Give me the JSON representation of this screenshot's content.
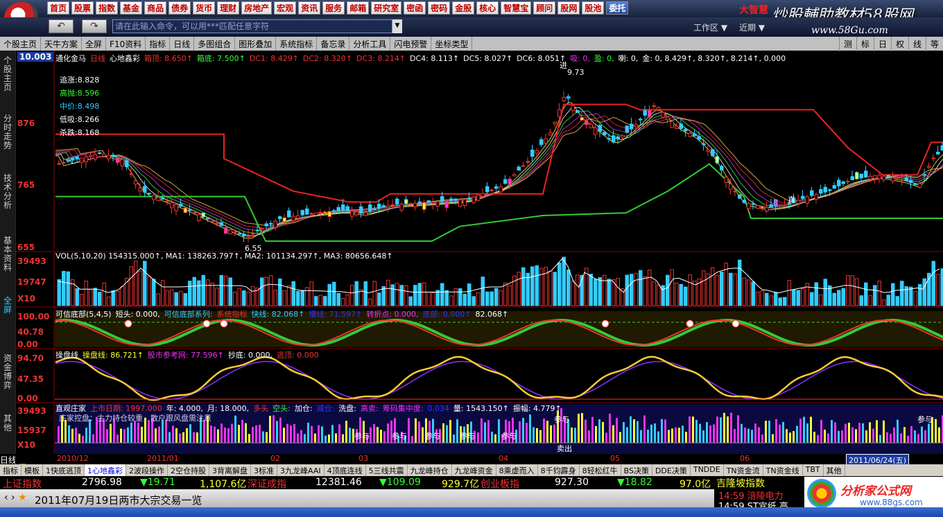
{
  "menu": [
    "首页",
    "股票",
    "指数",
    "基金",
    "商品",
    "债券",
    "货币",
    "理财",
    "房地产",
    "宏观",
    "资讯",
    "服务",
    "邮箱",
    "研究室",
    "密函",
    "密码",
    "金股",
    "核心",
    "智慧宝",
    "顾问",
    "股网",
    "股池",
    "委托"
  ],
  "brand": "大智慧",
  "watermark": "炒股輔助教材58股网",
  "watermark_url": "www.58Gu.com",
  "cmd": {
    "placeholder": "请在此输入命令，可以用***匹配任意字符"
  },
  "workarea": "工作区 ▼",
  "recent": "近期 ▼",
  "toolbar": [
    "个股主页",
    "天牛方案",
    "全屏",
    "F10资料",
    "指标",
    "日线",
    "多图组合",
    "图形叠加",
    "系统指标",
    "备忘录",
    "分析工具",
    "闪电预警",
    "坐标类型"
  ],
  "toolbar_right": [
    "测",
    "标",
    "日",
    "权",
    "线",
    "等"
  ],
  "sidetabs": [
    "个股主页",
    "分时走势",
    "技术分析",
    "基本资料",
    "全屏",
    "资金博弈",
    "其他"
  ],
  "main": {
    "header": [
      [
        "通化金马",
        "#fff"
      ],
      [
        "日线",
        "#e33"
      ],
      [
        "心地鑫彩",
        "#fff"
      ],
      [
        "箱顶: 8.650↑",
        "#e33"
      ],
      [
        "箱底: 7.500↑",
        "#3f3"
      ],
      [
        "DC1: 8.429↑",
        "#e33"
      ],
      [
        "DC2: 8.320↑",
        "#e33"
      ],
      [
        "DC3: 8.214↑",
        "#e33"
      ],
      [
        "DC4: 8.113↑",
        "#fff"
      ],
      [
        "DC5: 8.027↑",
        "#fff"
      ],
      [
        "DC6: 8.051↑",
        "#fff"
      ],
      [
        "吸: 0,",
        "#e3e"
      ],
      [
        "盈: 0,",
        "#3f3"
      ],
      [
        "喇: 0,",
        "#fff"
      ],
      [
        "金: 0, 8.429↑, 8.320↑, 8.214↑, 0.000",
        "#fff"
      ]
    ],
    "notes": [
      [
        "追涨:8.828",
        "#fff"
      ],
      [
        "高抛:8.596",
        "#3f3"
      ],
      [
        "中价:8.498",
        "#3cf"
      ],
      [
        "低吸:8.266",
        "#fff"
      ],
      [
        "杀跌:8.168",
        "#fff"
      ]
    ],
    "ylabels": [
      "10.003",
      "876",
      "765",
      "655"
    ],
    "mark_high": "9.73",
    "mark_low": "6.55",
    "mark_jin": "进",
    "mark_zhi": "直"
  },
  "vol": {
    "header": "VOL(5,10,20) 154315.000↑, MA1: 138263.797↑, MA2: 101134.297↑, MA3: 80656.648↑",
    "ylabels": [
      "39493",
      "19747",
      "X10"
    ]
  },
  "kd": {
    "header": [
      [
        "可信底部(5,4,5)",
        "#fff"
      ],
      [
        "短头: 0.000,",
        "#fff"
      ],
      [
        "可信底部系列:",
        "#3cf"
      ],
      [
        "系统指标",
        "#e33"
      ],
      [
        "快线: 82.068↑",
        "#3cf"
      ],
      [
        "慢线: 71.597↑",
        "#33f"
      ],
      [
        "转折点: 0.000,",
        "#e3e"
      ],
      [
        "底部: 0.000↑",
        "#33f"
      ],
      [
        "82.068↑",
        "#fff"
      ]
    ],
    "ylabels": [
      "100.00",
      "40.78",
      "0.00"
    ]
  },
  "cp": {
    "header": [
      [
        "操盘线",
        "#fff"
      ],
      [
        "操盘线: 86.721↑",
        "#ff3"
      ],
      [
        "股市参考网: 77.596↑",
        "#e3e"
      ],
      [
        "抄底: 0.000,",
        "#fff"
      ],
      [
        "逃顶: 0.000",
        "#e33"
      ]
    ],
    "ylabels": [
      "94.70",
      "47.35",
      "0.00"
    ]
  },
  "zz": {
    "header": [
      [
        "直观庄家",
        "#fff"
      ],
      [
        "上市日期: 1997.000",
        "#e33"
      ],
      [
        "年: 4.000,",
        "#fff"
      ],
      [
        "月: 18.000,",
        "#fff"
      ],
      [
        "多头",
        "#e33"
      ],
      [
        "空头:",
        "#3f3"
      ],
      [
        "加仓:",
        "#fff"
      ],
      [
        "减仓:",
        "#33f"
      ],
      [
        "洗盘:",
        "#fff"
      ],
      [
        "高卖:",
        "#e3e"
      ],
      [
        "筹码集中度:",
        "#e3e"
      ],
      [
        "0.034",
        "#33f"
      ],
      [
        "量: 1543.150↑",
        "#fff"
      ],
      [
        "振幅: 4.779↑",
        "#fff"
      ]
    ],
    "ylabels": [
      "39493",
      "15937",
      "X10"
    ],
    "tags": [
      "参与",
      "参与",
      "参与",
      "参与",
      "参与",
      "参与",
      "卖出",
      "参与"
    ],
    "note": "庄家控盘：主力持仓较重，散户跟风盘需注意"
  },
  "dates": [
    [
      "2010/12",
      60
    ],
    [
      "2011/01",
      190
    ],
    [
      "02",
      368
    ],
    [
      "03",
      495
    ],
    [
      "04",
      697
    ],
    [
      "05",
      858
    ],
    [
      "06",
      1045
    ]
  ],
  "day": "日线",
  "curdate": "2011/06/24(五)",
  "indtabs": [
    "指标",
    "模板",
    "1快底逃顶",
    "1心地鑫彩",
    "2波段操作",
    "2空仓持股",
    "3背离解盘",
    "3标准",
    "3九龙峰AAI",
    "4顶底连线",
    "5三线共震",
    "九龙峰持仓",
    "九龙峰资金",
    "8乘虚而入",
    "8千钧霹身",
    "8轻松红牛",
    "BS决策",
    "DDE决策",
    "TNDDE",
    "TN资金流",
    "TN资金线",
    "TBT",
    "其他"
  ],
  "ticker": [
    [
      "上证指数",
      "#e33",
      4
    ],
    [
      "2796.98",
      "#fff",
      118
    ],
    [
      "▼19.71",
      "#3f3",
      202
    ],
    [
      "1,107.6亿",
      "#ff3",
      288
    ],
    [
      "深证成指",
      "#e33",
      357
    ],
    [
      "12381.46",
      "#fff",
      455
    ],
    [
      "▼109.09",
      "#3f3",
      547
    ],
    [
      "929.7亿",
      "#ff3",
      637
    ],
    [
      "创业板指",
      "#e33",
      693
    ],
    [
      "927.30",
      "#fff",
      800
    ],
    [
      "▼18.82",
      "#3f3",
      890
    ],
    [
      "97.0亿",
      "#ff3",
      980
    ]
  ],
  "bottom": "2011年07月19日两市大宗交易一览",
  "rightpanel": {
    "title": "吉隆坡指数",
    "l1": "14:59 涪陵电力",
    "l2": "14:59 ST宜纸 高"
  },
  "brand2": "分析家公式网",
  "brand2_url": "www.88gs.com"
}
